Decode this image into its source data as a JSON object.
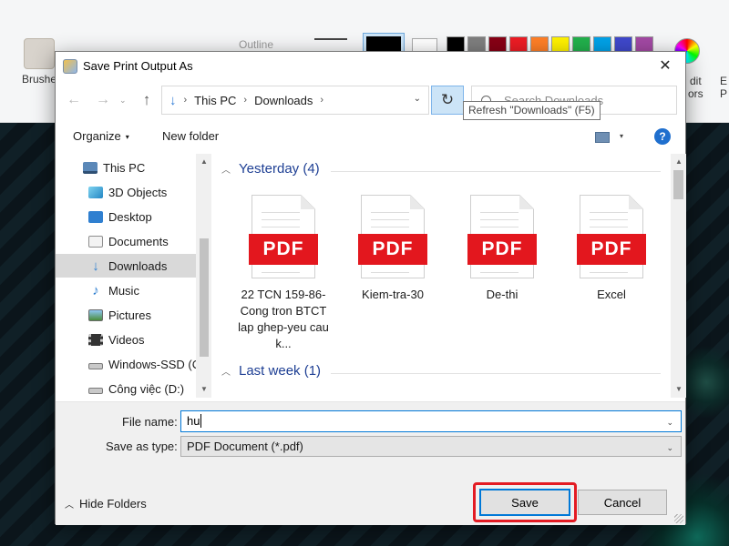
{
  "background_app": {
    "ribbon": {
      "brushes_label": "Brushe",
      "outline_label": "Outline",
      "edit_colors_fragment": "dit",
      "colors_fragment": "ors",
      "edge_e": "E",
      "edge_p": "P",
      "palette": [
        "#000000",
        "#7f7f7f",
        "#880015",
        "#ed1c24",
        "#ff7f27",
        "#fff200",
        "#22b14c",
        "#00a2e8",
        "#3f48cc",
        "#a349a4"
      ]
    }
  },
  "dialog": {
    "title": "Save Print Output As",
    "close_icon": "✕",
    "nav": {
      "back_icon": "←",
      "forward_icon": "→",
      "up_icon": "↑",
      "recent_icon": "⌄",
      "refresh_icon": "↻"
    },
    "address": {
      "breadcrumbs": [
        "This PC",
        "Downloads"
      ],
      "separator": "›",
      "dropdown_icon": "⌄"
    },
    "search": {
      "placeholder": "Search Downloads"
    },
    "tooltip": "Refresh \"Downloads\" (F5)",
    "toolbar": {
      "organize_label": "Organize",
      "organize_caret": "▾",
      "new_folder_label": "New folder",
      "view_caret": "▾",
      "help_label": "?"
    },
    "nav_pane": {
      "items": [
        {
          "label": "This PC",
          "icon": "computer-icon"
        },
        {
          "label": "3D Objects",
          "icon": "cube-icon"
        },
        {
          "label": "Desktop",
          "icon": "desktop-icon"
        },
        {
          "label": "Documents",
          "icon": "document-icon"
        },
        {
          "label": "Downloads",
          "icon": "download-arrow-icon",
          "selected": true
        },
        {
          "label": "Music",
          "icon": "music-note-icon"
        },
        {
          "label": "Pictures",
          "icon": "picture-icon"
        },
        {
          "label": "Videos",
          "icon": "film-icon"
        },
        {
          "label": "Windows-SSD (C",
          "icon": "drive-icon"
        },
        {
          "label": "Công việc (D:)",
          "icon": "drive-icon"
        }
      ],
      "scroll_up": "▲",
      "scroll_down": "▼"
    },
    "file_pane": {
      "groups": [
        {
          "header": "Yesterday (4)",
          "chevron": "︿",
          "files": [
            {
              "name": "22 TCN 159-86-Cong tron BTCT lap ghep-yeu cau k...",
              "type_label": "PDF"
            },
            {
              "name": "Kiem-tra-30",
              "type_label": "PDF"
            },
            {
              "name": "De-thi",
              "type_label": "PDF"
            },
            {
              "name": "Excel",
              "type_label": "PDF"
            }
          ]
        },
        {
          "header": "Last week (1)",
          "chevron": "︿",
          "files": []
        }
      ],
      "scroll_up": "▲",
      "scroll_down": "▼"
    },
    "form": {
      "filename_label": "File name:",
      "filename_value": "hu",
      "filename_caret": "⌄",
      "savetype_label": "Save as type:",
      "savetype_value": "PDF Document (*.pdf)",
      "savetype_caret": "⌄",
      "hide_folders_chevron": "︿",
      "hide_folders_label": "Hide Folders",
      "save_label": "Save",
      "cancel_label": "Cancel"
    }
  }
}
